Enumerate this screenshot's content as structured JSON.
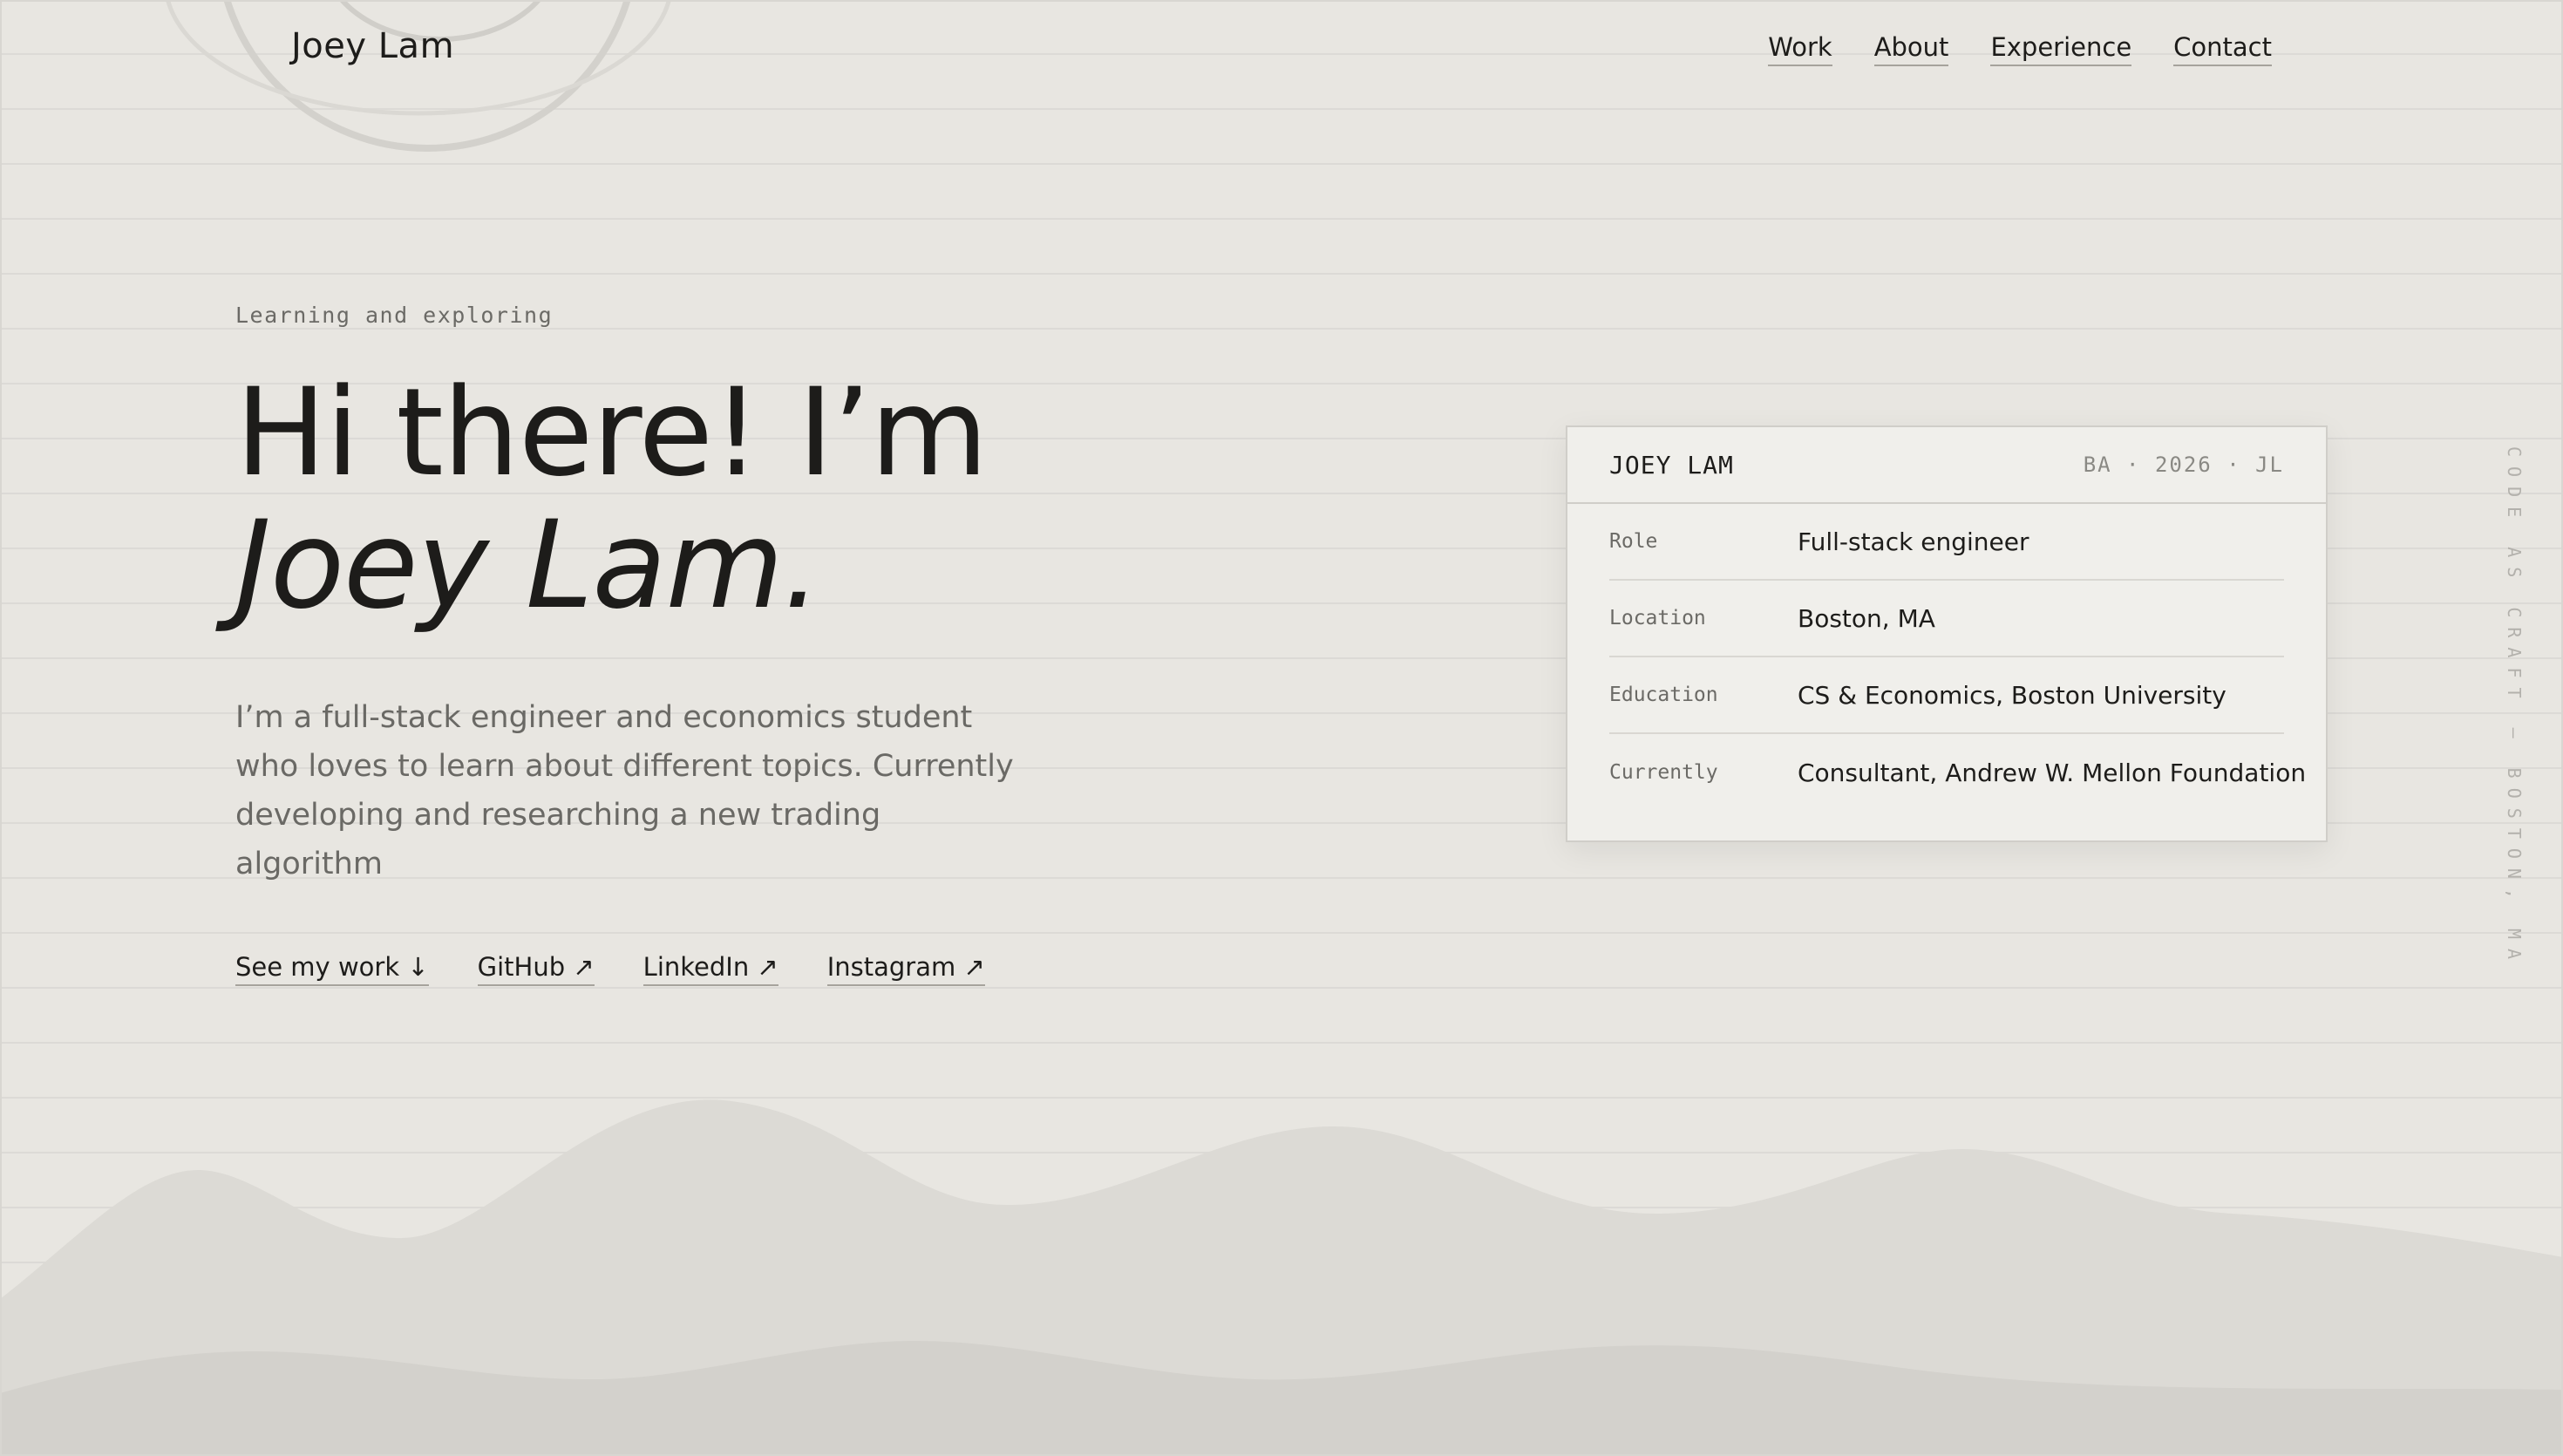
{
  "brand": {
    "name": "Joey Lam"
  },
  "nav": {
    "items": [
      "Work",
      "About",
      "Experience",
      "Contact"
    ]
  },
  "hero": {
    "eyebrow": "Learning and exploring",
    "greeting": "Hi there! I’m",
    "name": "Joey Lam.",
    "intro": "I’m a full-stack engineer and economics student who loves to learn about different topics. Currently developing and researching a new trading algorithm"
  },
  "links": {
    "see_work": "See my work ↓",
    "github": "GitHub ↗",
    "linkedin": "LinkedIn ↗",
    "instagram": "Instagram ↗"
  },
  "card": {
    "title": "JOEY LAM",
    "meta": "BA · 2026 · JL",
    "rows": [
      {
        "label": "Role",
        "value": "Full-stack engineer"
      },
      {
        "label": "Location",
        "value": "Boston, MA"
      },
      {
        "label": "Education",
        "value": "CS & Economics, Boston University"
      },
      {
        "label": "Currently",
        "value": "Consultant, Andrew W. Mellon Foundation"
      }
    ]
  },
  "side_caption": "CODE AS CRAFT — BOSTON, MA",
  "colors": {
    "background": "#e8e6e1",
    "text": "#1d1c1a",
    "muted": "#6a6965",
    "card": "#f0efeb"
  }
}
